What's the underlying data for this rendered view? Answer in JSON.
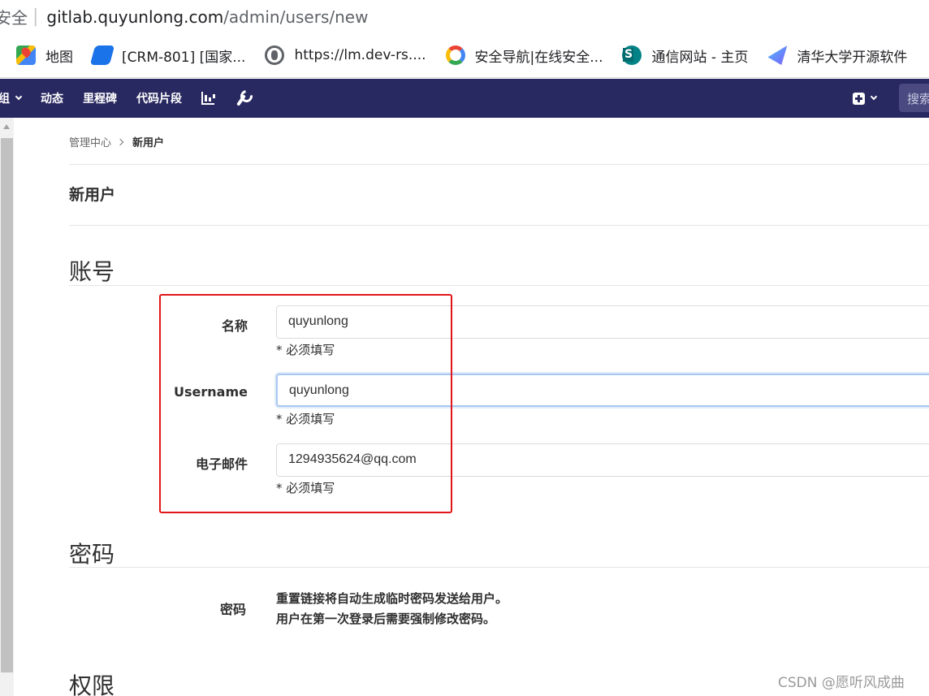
{
  "browser": {
    "security": "安全",
    "url_host": "gitlab.quyunlong.com",
    "url_path": "/admin/users/new",
    "bookmarks": [
      {
        "label": "地图",
        "icon": "google-maps-icon"
      },
      {
        "label": "[CRM-801] [国家...",
        "icon": "jira-icon"
      },
      {
        "label": "https://lm.dev-rs....",
        "icon": "globe-icon"
      },
      {
        "label": "安全导航|在线安全...",
        "icon": "google-icon"
      },
      {
        "label": "通信网站 - 主页",
        "icon": "sharepoint-icon"
      },
      {
        "label": "清华大学开源软件",
        "icon": "tsinghua-mirror-icon"
      }
    ]
  },
  "navbar": {
    "groups_fragment": "组",
    "activity": "动态",
    "milestones": "里程碑",
    "snippets": "代码片段",
    "search_placeholder": "搜索"
  },
  "breadcrumb": {
    "parent": "管理中心",
    "current": "新用户"
  },
  "page_title": "新用户",
  "account": {
    "title": "账号",
    "name_label": "名称",
    "name_value": "quyunlong",
    "username_label": "Username",
    "username_value": "quyunlong",
    "email_label": "电子邮件",
    "email_value": "1294935624@qq.com",
    "required_hint": "* 必须填写"
  },
  "password": {
    "title": "密码",
    "label": "密码",
    "note_line1": "重置链接将自动生成临时密码发送给用户。",
    "note_line2": "用户在第一次登录后需要强制修改密码。"
  },
  "permissions": {
    "title": "权限"
  },
  "watermark": "CSDN @愿听风成曲",
  "colors": {
    "navbar": "#292961",
    "highlight_box": "#e0161a"
  }
}
